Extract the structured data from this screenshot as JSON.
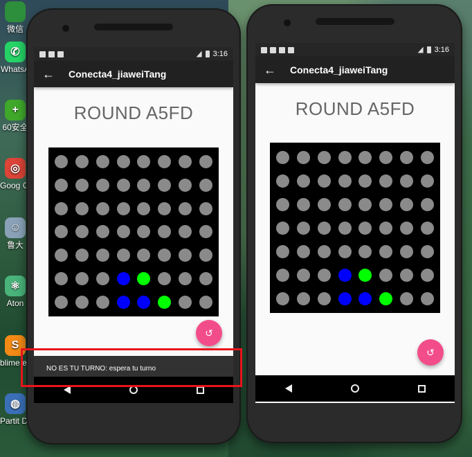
{
  "desktop": {
    "icons": [
      {
        "label": "微信",
        "glyph": "",
        "color": "#2d8f3c",
        "icon": "wechat-icon"
      },
      {
        "label": "WhatsA",
        "glyph": "✆",
        "color": "#25d366",
        "icon": "whatsapp-icon"
      },
      {
        "label": "60安全",
        "glyph": "+",
        "color": "#3fa82a",
        "icon": "360-security-icon"
      },
      {
        "label": "Goog Chron",
        "glyph": "◎",
        "color": "#db4437",
        "icon": "chrome-icon"
      },
      {
        "label": "鲁大",
        "glyph": "☺",
        "color": "#8aa2b8",
        "icon": "ludashi-icon"
      },
      {
        "label": "Aton",
        "glyph": "⚛",
        "color": "#49b37a",
        "icon": "atom-icon"
      },
      {
        "label": "blime exe",
        "glyph": "S",
        "color": "#f28a15",
        "icon": "sublime-icon"
      },
      {
        "label": "Partit Desktop",
        "glyph": "◍",
        "color": "#3b6fb8",
        "icon": "partition-icon"
      }
    ]
  },
  "phone_left": {
    "status_time": "3:16",
    "app_title": "Conecta4_jiaweiTang",
    "round_title": "ROUND A5FD",
    "board": [
      [
        "g",
        "g",
        "g",
        "g",
        "g",
        "g",
        "g",
        "g"
      ],
      [
        "g",
        "g",
        "g",
        "g",
        "g",
        "g",
        "g",
        "g"
      ],
      [
        "g",
        "g",
        "g",
        "g",
        "g",
        "g",
        "g",
        "g"
      ],
      [
        "g",
        "g",
        "g",
        "g",
        "g",
        "g",
        "g",
        "g"
      ],
      [
        "g",
        "g",
        "g",
        "g",
        "g",
        "g",
        "g",
        "g"
      ],
      [
        "g",
        "g",
        "g",
        "b",
        "G",
        "g",
        "g",
        "g"
      ],
      [
        "g",
        "g",
        "g",
        "b",
        "b",
        "G",
        "g",
        "g"
      ]
    ],
    "snackbar_text": "NO ES TU TURNO: espera tu turno",
    "fab_icon": "undo-icon"
  },
  "phone_right": {
    "status_time": "3:16",
    "app_title": "Conecta4_jiaweiTang",
    "round_title": "ROUND A5FD",
    "board": [
      [
        "g",
        "g",
        "g",
        "g",
        "g",
        "g",
        "g",
        "g"
      ],
      [
        "g",
        "g",
        "g",
        "g",
        "g",
        "g",
        "g",
        "g"
      ],
      [
        "g",
        "g",
        "g",
        "g",
        "g",
        "g",
        "g",
        "g"
      ],
      [
        "g",
        "g",
        "g",
        "g",
        "g",
        "g",
        "g",
        "g"
      ],
      [
        "g",
        "g",
        "g",
        "g",
        "g",
        "g",
        "g",
        "g"
      ],
      [
        "g",
        "g",
        "g",
        "b",
        "G",
        "g",
        "g",
        "g"
      ],
      [
        "g",
        "g",
        "g",
        "b",
        "b",
        "G",
        "g",
        "g"
      ]
    ],
    "fab_icon": "undo-icon"
  },
  "icons": {
    "back": "←",
    "undo": "↺"
  },
  "colors": {
    "empty_disc": "#8a8a8a",
    "player_blue": "#0000ff",
    "player_green": "#00ff00",
    "fab": "#f24d8a",
    "highlight": "#e8141c"
  }
}
